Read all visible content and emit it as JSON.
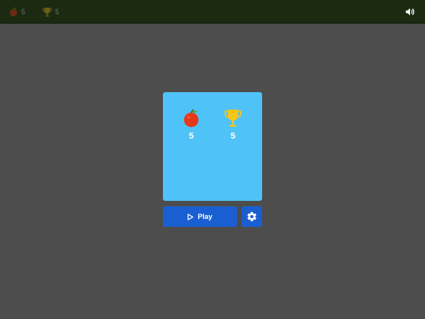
{
  "hud": {
    "apples": "5",
    "trophies": "5",
    "apple_icon": "apple-icon",
    "trophy_icon": "trophy-icon",
    "sound_icon": "speaker-icon"
  },
  "card": {
    "apples": "5",
    "trophies": "5"
  },
  "buttons": {
    "play_label": "Play",
    "play_icon": "play-icon",
    "settings_icon": "gear-icon"
  },
  "colors": {
    "background": "#4d4d4d",
    "topbar": "#1c2a12",
    "card": "#4fc3f7",
    "button": "#1a5fd1",
    "apple": "#e53919",
    "trophy": "#f5c518"
  }
}
